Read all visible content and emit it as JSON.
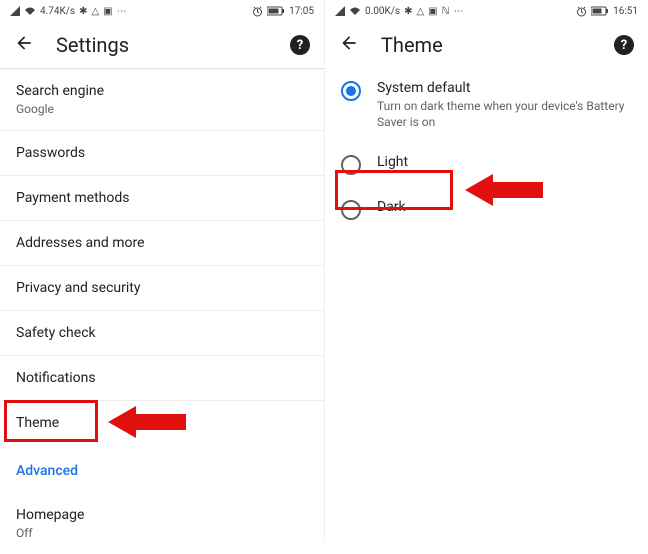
{
  "left": {
    "status": {
      "speed": "4.74K/s",
      "time": "17:05"
    },
    "header": {
      "title": "Settings"
    },
    "items": [
      {
        "label": "Search engine",
        "sub": "Google"
      },
      {
        "label": "Passwords"
      },
      {
        "label": "Payment methods"
      },
      {
        "label": "Addresses and more"
      },
      {
        "label": "Privacy and security"
      },
      {
        "label": "Safety check"
      },
      {
        "label": "Notifications"
      },
      {
        "label": "Theme"
      }
    ],
    "advanced": "Advanced",
    "homepage": {
      "label": "Homepage",
      "sub": "Off"
    }
  },
  "right": {
    "status": {
      "speed": "0.00K/s",
      "time": "16:51"
    },
    "header": {
      "title": "Theme"
    },
    "options": [
      {
        "label": "System default",
        "sub": "Turn on dark theme when your device's Battery Saver is on",
        "selected": true
      },
      {
        "label": "Light",
        "selected": false
      },
      {
        "label": "Dark",
        "selected": false
      }
    ]
  },
  "colors": {
    "highlight": "#e20f0f",
    "arrow": "#e20f0f",
    "link": "#1a73e8"
  }
}
